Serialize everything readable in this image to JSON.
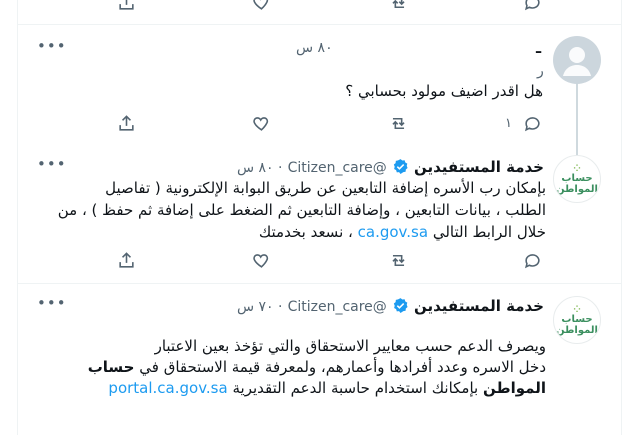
{
  "tweets": [
    {
      "author": {
        "name_partial": "ـ",
        "handle_partial": "ر"
      },
      "time": "٨٠ س",
      "text": "هل اقدر اضيف مولود بحسابي ؟",
      "reply_count": "١"
    },
    {
      "author": {
        "name": "خدمة المستفيدين",
        "handle": "@Citizen_care"
      },
      "time": "٨٠ س",
      "text_lines": [
        "بإمكان رب الأسره إضافة التابعين عن طريق البوابة الإلكترونية ( تفاصيل",
        "الطلب ، بيانات التابعين ، وإضافة التابعين ثم الضغط على إضافة ثم حفظ ) ، من",
        "خلال الرابط التالي",
        "، نسعد بخدمتك"
      ],
      "link": "ca.gov.sa"
    },
    {
      "author": {
        "name": "خدمة المستفيدين",
        "handle": "@Citizen_care"
      },
      "time": "٧٠ س",
      "text_lines": [
        "ويصرف الدعم حسب معايير الاستحقاق والتي تؤخذ بعين الاعتبار",
        "دخل الاسره وعدد أفرادها وأعمارهم، ولمعرفة قيمة الاستحقاق في",
        "حساب",
        "المواطن",
        "بإمكانك استخدام حاسبة الدعم التقديرية"
      ],
      "link": "portal.ca.gov.sa"
    }
  ],
  "brand": {
    "line1": "حساب",
    "line2": "المواطن"
  },
  "icons": [
    "reply-icon",
    "retweet-icon",
    "like-icon",
    "share-icon",
    "more-icon",
    "verified-icon"
  ],
  "colors": {
    "link": "#1d9bf0",
    "secondary": "#536471",
    "verified": "#1d9bf0",
    "divider": "#eff3f4"
  }
}
